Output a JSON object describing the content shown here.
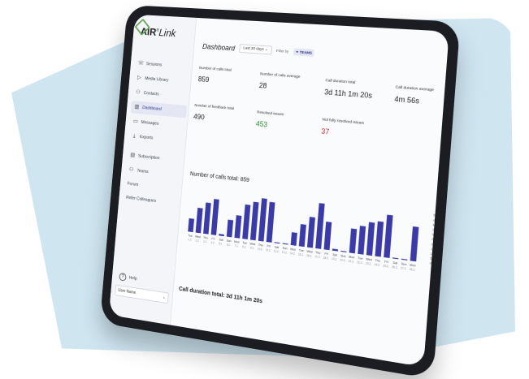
{
  "app": {
    "logo_main": "AIR",
    "logo_sup": "®",
    "logo_sub": "Link"
  },
  "sidebar": {
    "items": [
      {
        "label": "Sessions",
        "icon": "phone-icon"
      },
      {
        "label": "Media Library",
        "icon": "play-icon"
      },
      {
        "label": "Contacts",
        "icon": "people-icon"
      },
      {
        "label": "Dashboard",
        "icon": "chart-icon",
        "active": true
      },
      {
        "label": "Messages",
        "icon": "message-icon"
      },
      {
        "label": "Exports",
        "icon": "download-icon"
      }
    ],
    "group": [
      {
        "label": "Subscription",
        "icon": "card-icon"
      },
      {
        "label": "Teams",
        "icon": "people-icon"
      }
    ],
    "plain": [
      "Forum",
      "Refer Colleagues"
    ],
    "help": "Help",
    "user": "User Name"
  },
  "header": {
    "title": "Dashboard",
    "period": "Last 30 days",
    "filter_label": "Filter by",
    "filter_chip": "TEAMS"
  },
  "cards": [
    {
      "label": "Number of calls total",
      "value": "859",
      "color": ""
    },
    {
      "label": "Number of calls average",
      "value": "28",
      "color": ""
    },
    {
      "label": "Call duration total",
      "value": "3d 11h 1m 20s",
      "color": ""
    },
    {
      "label": "Call duration average",
      "value": "4m 56s",
      "color": ""
    },
    {
      "label": "Number of feedback total",
      "value": "490",
      "color": ""
    },
    {
      "label": "Resolved issues",
      "value": "453",
      "color": "green"
    },
    {
      "label": "Not fully resolved issues",
      "value": "37",
      "color": "red"
    }
  ],
  "chart_title": "Number of calls total: 859",
  "footer_title": "Call duration total: 3d 11h 1m 20s",
  "chart_data": {
    "type": "bar",
    "color": "#3b3ba8",
    "categories": [
      {
        "day": "Tue",
        "date": "1.2."
      },
      {
        "day": "Wed",
        "date": "2.2."
      },
      {
        "day": "Thu",
        "date": "3.2."
      },
      {
        "day": "Fri",
        "date": "4.2."
      },
      {
        "day": "Sat",
        "date": "5.2."
      },
      {
        "day": "Sun",
        "date": "6.2."
      },
      {
        "day": "Mon",
        "date": "7.2."
      },
      {
        "day": "Tue",
        "date": "8.2."
      },
      {
        "day": "Wed",
        "date": "9.2."
      },
      {
        "day": "Thu",
        "date": "10.2."
      },
      {
        "day": "Fri",
        "date": "11.2."
      },
      {
        "day": "Sat",
        "date": "12.2."
      },
      {
        "day": "Sun",
        "date": "13.2."
      },
      {
        "day": "Mon",
        "date": "14.2."
      },
      {
        "day": "Tue",
        "date": "15.2."
      },
      {
        "day": "Wed",
        "date": "16.2."
      },
      {
        "day": "Thu",
        "date": "17.2."
      },
      {
        "day": "Fri",
        "date": "18.2."
      },
      {
        "day": "Sat",
        "date": "19.2."
      },
      {
        "day": "Sun",
        "date": "20.2."
      },
      {
        "day": "Mon",
        "date": "21.2."
      },
      {
        "day": "Tue",
        "date": "22.2."
      },
      {
        "day": "Wed",
        "date": "23.2."
      },
      {
        "day": "Thu",
        "date": "24.2."
      },
      {
        "day": "Fri",
        "date": "25.2."
      },
      {
        "day": "Sat",
        "date": "26.2."
      },
      {
        "day": "Sun",
        "date": "27.2."
      },
      {
        "day": "Mon",
        "date": "28.2."
      }
    ],
    "values": [
      15,
      28,
      35,
      40,
      2,
      19,
      25,
      38,
      42,
      47,
      44,
      1,
      1,
      14,
      24,
      33,
      49,
      30,
      2,
      1,
      26,
      30,
      35,
      37,
      45,
      1,
      1,
      36
    ],
    "yticks": [
      0,
      5,
      10,
      15,
      20,
      25,
      30,
      35,
      40,
      45,
      50
    ],
    "ylim": [
      0,
      50
    ]
  }
}
